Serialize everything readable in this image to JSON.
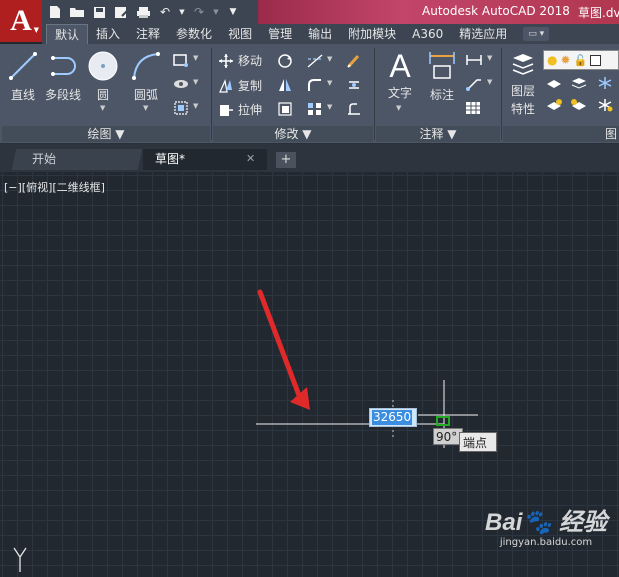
{
  "window": {
    "title": "Autodesk AutoCAD 2018",
    "filename": "草图.dv"
  },
  "ribbon_tabs": [
    "默认",
    "插入",
    "注释",
    "参数化",
    "视图",
    "管理",
    "输出",
    "附加模块",
    "A360",
    "精选应用"
  ],
  "draw_panel": {
    "title": "绘图 ▼",
    "line": "直线",
    "polyline": "多段线",
    "circle": "圆",
    "arc": "圆弧"
  },
  "modify_panel": {
    "title": "修改 ▼",
    "move": "移动",
    "copy": "复制",
    "stretch": "拉伸"
  },
  "annotation_panel": {
    "title": "注释 ▼",
    "text": "文字",
    "dimension": "标注"
  },
  "layers_panel": {
    "properties_line1": "图层",
    "properties_line2": "特性",
    "title_partial": "图"
  },
  "file_tabs": {
    "start": "开始",
    "drawing": "草图*",
    "add": "+"
  },
  "canvas": {
    "viewport_label": "[−][俯视][二维线框]",
    "dynamic_input_value": "32650",
    "angle_tooltip": "90°",
    "snap_tooltip": "端点",
    "ucs_axis": "Y"
  },
  "watermark": {
    "logo": "Bai🐾 经验",
    "url": "jingyan.baidu.com"
  },
  "colors": {
    "accent_red": "#b01f1f",
    "title_gradient": "#c2456a",
    "ribbon_bg": "#4c5666",
    "canvas_bg": "#212830",
    "arrow_red": "#e02a2a",
    "snap_green": "#22aa22"
  }
}
